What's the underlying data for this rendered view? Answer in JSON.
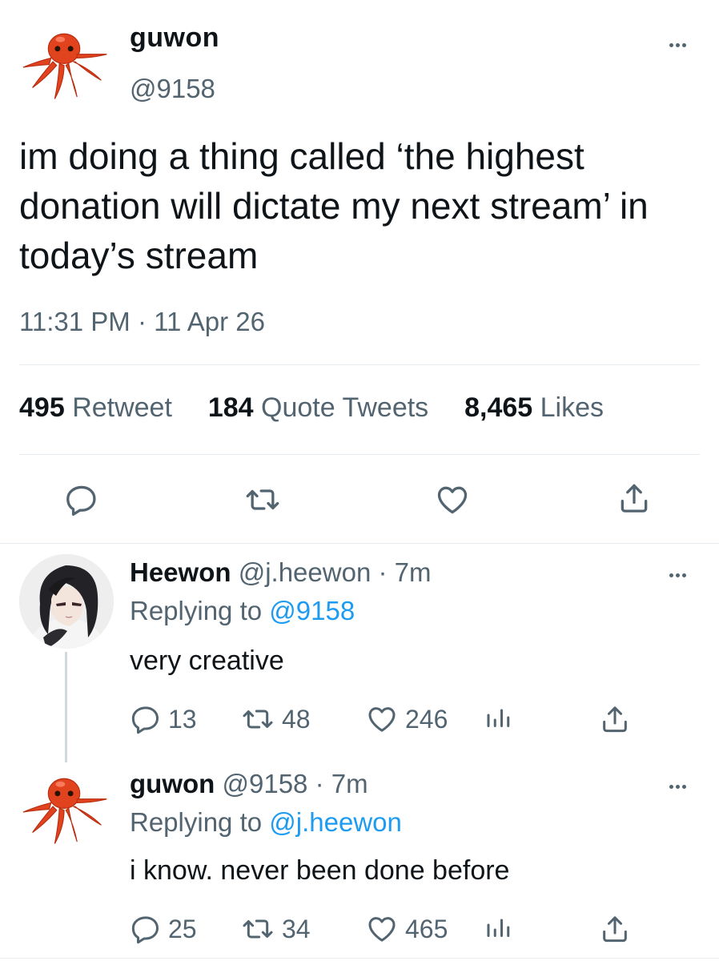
{
  "main_tweet": {
    "display_name": "guwon",
    "handle": "@9158",
    "text": "im doing a thing called ‘the highest donation will dictate my next stream’ in today’s stream",
    "timestamp": "11:31 PM · 11 Apr 26",
    "stats": {
      "retweets_count": "495",
      "retweets_label": "Retweet",
      "quotes_count": "184",
      "quotes_label": "Quote Tweets",
      "likes_count": "8,465",
      "likes_label": "Likes"
    }
  },
  "replies": [
    {
      "display_name": "Heewon",
      "handle": "@j.heewon",
      "time": "· 7m",
      "replying_prefix": "Replying to",
      "replying_to": "@9158",
      "text": "very creative",
      "reply_count": "13",
      "retweet_count": "48",
      "like_count": "246"
    },
    {
      "display_name": "guwon",
      "handle": "@9158",
      "time": "· 7m",
      "replying_prefix": "Replying to",
      "replying_to": "@j.heewon",
      "text": "i know. never been done before",
      "reply_count": "25",
      "retweet_count": "34",
      "like_count": "465"
    }
  ],
  "icons": {
    "reply": "reply-icon",
    "retweet": "retweet-icon",
    "like": "heart-icon",
    "share": "share-icon",
    "analytics": "analytics-icon",
    "more": "more-icon"
  },
  "colors": {
    "text": "#0f1419",
    "secondary": "#536471",
    "link": "#1d9bf0",
    "divider": "#e6ecf0",
    "octopus": "#e2431f"
  }
}
